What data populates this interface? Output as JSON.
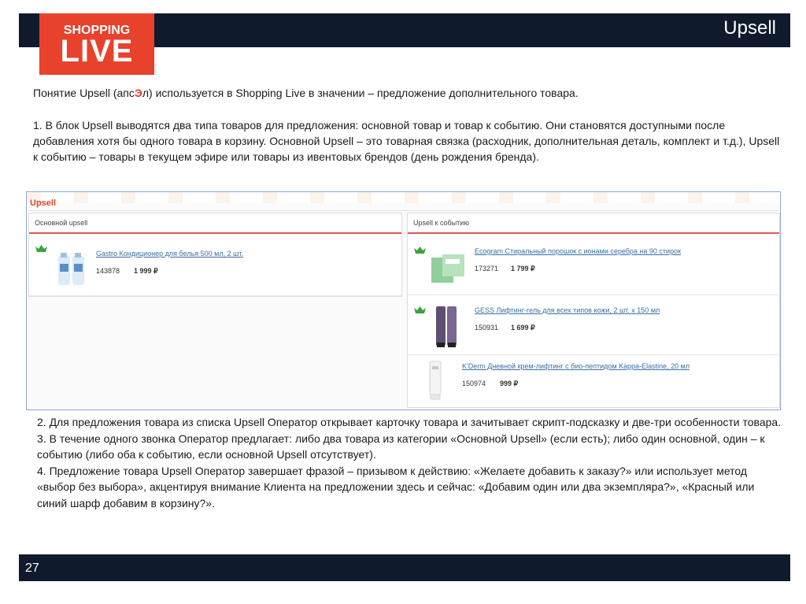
{
  "slide": {
    "title": "Upsell",
    "page_number": "27",
    "logo": {
      "line1": "SHOPPING",
      "line2": "LIVE"
    }
  },
  "text": {
    "intro_before": "Понятие Upsell (апс",
    "intro_highlight": "Э",
    "intro_after": "л) используется в Shopping Live в значении – предложение дополнительного товара.",
    "p1": "1. В блок Upsell выводятся два типа товаров для предложения: основной товар и товар к событию. Они становятся доступными после добавления хотя бы одного товара в корзину. Основной Upsell – это товарная связка (расходник, дополнительная деталь, комплект и т.д.), Upsell к событию – товары в текущем эфире или товары из ивентовых брендов (день рождения бренда).",
    "p2": "2. Для предложения товара из списка Upsell Оператор открывает карточку товара и зачитывает скрипт-подсказку и две-три особенности товара.",
    "p3": "3. В течение одного звонка Оператор предлагает: либо два товара из категории «Основной Upsell» (если есть); либо один основной, один – к событию (либо оба к событию, если основной Upsell отсутствует).",
    "p4": "4. Предложение товара Upsell Оператор завершает фразой – призывом к действию: «Желаете добавить к заказу?» или использует метод «выбор без выбора», акцентируя внимание Клиента на предложении здесь и сейчас: «Добавим один или два экземпляра?», «Красный или синий шарф добавим в корзину?»."
  },
  "ui": {
    "header": "Upsell",
    "main_box": {
      "title": "Основной upsell",
      "items": [
        {
          "name": "Gastro Кондиционер для белья 500 мл, 2 шт.",
          "code": "143878",
          "price": "1 999 ₽"
        }
      ]
    },
    "event_box": {
      "title": "Upsell к событию",
      "items": [
        {
          "name": "Ecogram Стиральный порошок с ионами серебра на 90 стирок",
          "code": "173271",
          "price": "1 799 ₽"
        },
        {
          "name": "GESS Лифтинг-гель для всех типов кожи, 2 шт. х 150 мл",
          "code": "150931",
          "price": "1 699 ₽"
        },
        {
          "name": "K'Derm Дневной крем-лифтинг с био-пептидом Kappa-Elastine, 20 мл",
          "code": "150974",
          "price": "999 ₽"
        }
      ]
    }
  },
  "colors": {
    "brand": "#e8412c",
    "navy": "#0f1a2c",
    "link": "#3a6ea5",
    "crown": "#3aa33a"
  }
}
